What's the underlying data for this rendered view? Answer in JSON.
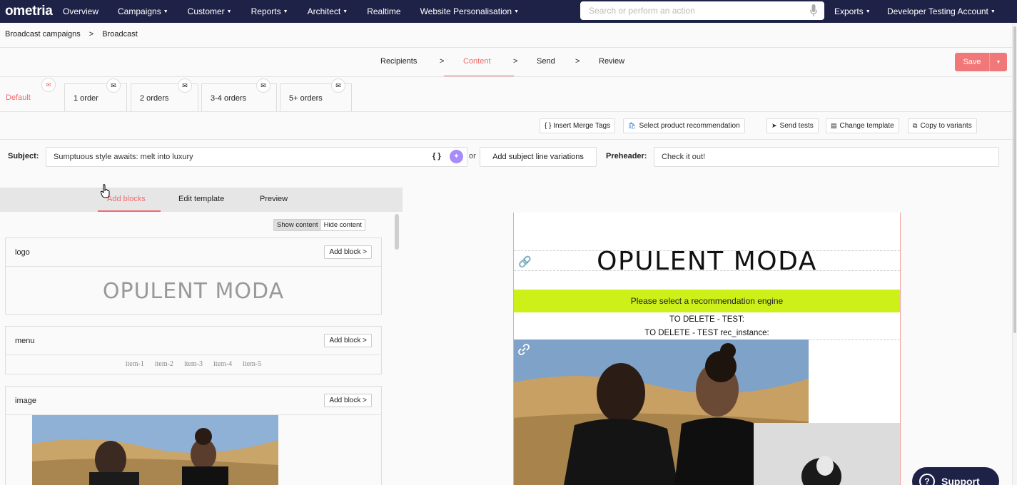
{
  "nav": {
    "logo": "ometria",
    "items": [
      {
        "label": "Overview",
        "caret": false
      },
      {
        "label": "Campaigns",
        "caret": true
      },
      {
        "label": "Customer",
        "caret": true
      },
      {
        "label": "Reports",
        "caret": true
      },
      {
        "label": "Architect",
        "caret": true
      },
      {
        "label": "Realtime",
        "caret": false
      },
      {
        "label": "Website Personalisation",
        "caret": true
      }
    ],
    "search_placeholder": "Search or perform an action",
    "exports": "Exports",
    "account": "Developer Testing Account"
  },
  "breadcrumb": {
    "root": "Broadcast campaigns",
    "sep": ">",
    "current": "Broadcast"
  },
  "stepper": {
    "steps": [
      "Recipients",
      "Content",
      "Send",
      "Review"
    ],
    "active": "Content",
    "sep": ">",
    "save": "Save"
  },
  "variants": [
    "Default",
    "1 order",
    "2 orders",
    "3-4 orders",
    "5+ orders"
  ],
  "toolbar": {
    "merge_tags": "{ } Insert Merge Tags",
    "product_reco": "Select product recommendation",
    "send_tests": "Send tests",
    "change_template": "Change template",
    "copy_variants": "Copy to variants"
  },
  "subject": {
    "label": "Subject:",
    "value": "Sumptuous style awaits: melt into luxury",
    "merge_icon": "{ }",
    "or": "or",
    "variations": "Add subject line variations",
    "preheader_label": "Preheader:",
    "preheader_value": "Check it out!"
  },
  "panel": {
    "tabs": [
      "Add blocks",
      "Edit template",
      "Preview"
    ],
    "active_tab": "Add blocks",
    "show_content": "Show content",
    "hide_content": "Hide content",
    "add_block": "Add block >",
    "blocks": {
      "logo": {
        "title": "logo",
        "preview": "OPULENT MODA"
      },
      "menu": {
        "title": "menu",
        "items": [
          "item-1",
          "item-2",
          "item-3",
          "item-4",
          "item-5"
        ]
      },
      "image": {
        "title": "image"
      }
    }
  },
  "email": {
    "logo": "OPULENT MODA",
    "reco": "Please select a recommendation engine",
    "del1": "TO DELETE - TEST:",
    "del2": "TO DELETE - TEST rec_instance:"
  },
  "support": "Support",
  "colors": {
    "nav": "#1f2247",
    "accent": "#ef6b6b",
    "reco": "#cdf019"
  }
}
